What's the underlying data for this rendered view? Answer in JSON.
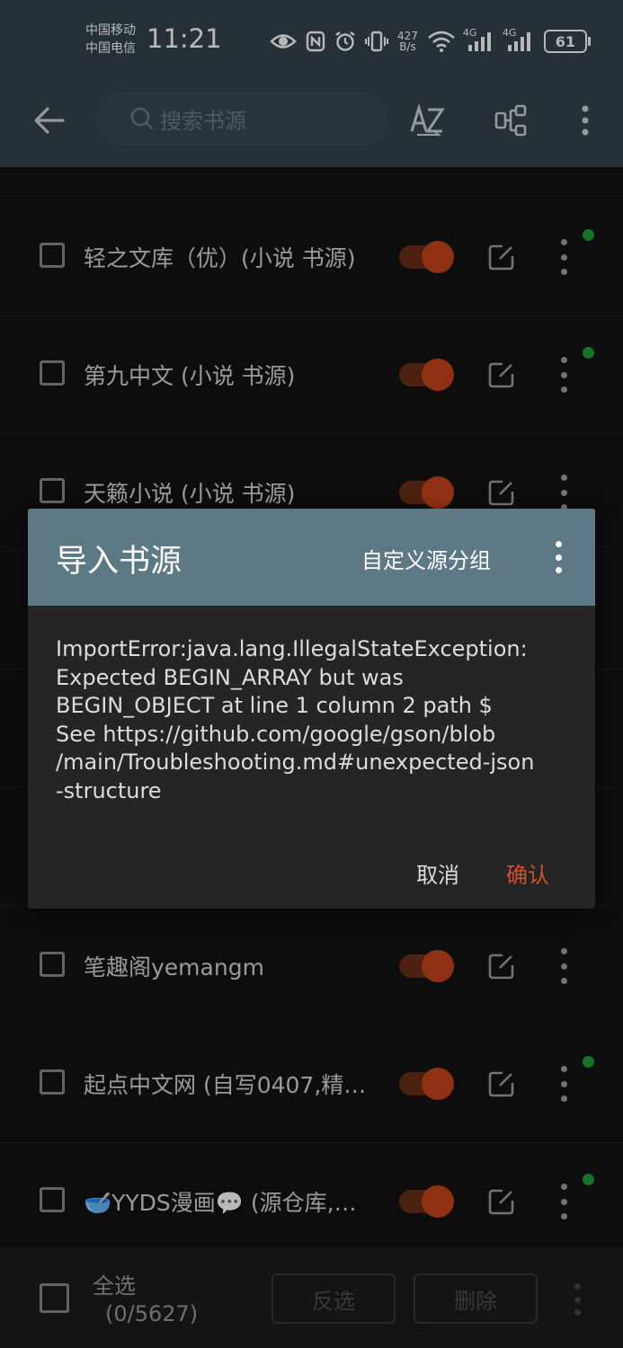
{
  "status_bar": {
    "carrier_1": "中国移动",
    "carrier_2": "中国电信",
    "time": "11:21",
    "net_speed_value": "427",
    "net_speed_unit": "B/s",
    "sig1_label": "4G",
    "sig2_label": "4G",
    "battery": "61",
    "icons": [
      "eye-icon",
      "nfc-icon",
      "alarm-icon",
      "vibrate-icon",
      "wifi-icon",
      "signal-icon",
      "signal-icon",
      "battery-icon"
    ]
  },
  "toolbar": {
    "search_placeholder": "搜索书源",
    "sort_icon": "sort-az-icon",
    "group_icon": "group-icon",
    "more_icon": "more-vert-icon"
  },
  "sources": [
    {
      "name": "轻之文库（优）(小说 书源)",
      "enabled": true,
      "dot": true
    },
    {
      "name": "第九中文 (小说 书源)",
      "enabled": true,
      "dot": true
    },
    {
      "name": "天籁小说 (小说 书源)",
      "enabled": true,
      "dot": false
    },
    {
      "name": "笔趣阁yemangm",
      "enabled": true,
      "dot": false
    },
    {
      "name": "起点中文网 (自写0407,精…",
      "enabled": true,
      "dot": true
    },
    {
      "name": "🥣YYDS漫画💬 (源仓库,…",
      "enabled": true,
      "dot": true
    }
  ],
  "dialog": {
    "title": "导入书源",
    "custom_group": "自定义源分组",
    "message": "ImportError:java.lang.IllegalStateException:\nExpected BEGIN_ARRAY but was\nBEGIN_OBJECT at line 1 column 2 path $\nSee https://github.com/google/gson/blob\n/main/Troubleshooting.md#unexpected-json\n-structure",
    "cancel": "取消",
    "confirm": "确认"
  },
  "bottom_bar": {
    "select_all": "全选",
    "count": "(0/5627)",
    "invert": "反选",
    "delete": "删除"
  },
  "colors": {
    "toolbar": "#34434d",
    "dialog_header": "#5d7985",
    "accent": "#c8431a",
    "confirm": "#d2512d",
    "dot": "#1f9e3a"
  }
}
